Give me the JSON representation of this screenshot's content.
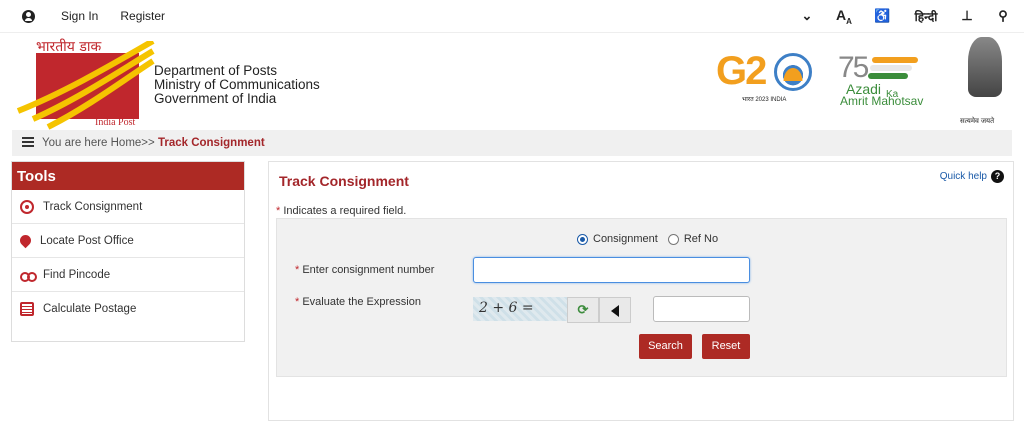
{
  "topbar": {
    "sign_in": "Sign In",
    "register": "Register",
    "hindi": "हिन्दी",
    "icons": [
      "user-icon",
      "chevron-down-icon",
      "font-size-icon",
      "accessibility-icon",
      "sitemap-icon",
      "search-icon"
    ]
  },
  "header": {
    "logo_hindi": "भारतीय डाक",
    "logo_english": "India Post",
    "dept_line1": "Department of Posts",
    "dept_line2": "Ministry of Communications",
    "dept_line3": "Government of India",
    "g20_text": "G20",
    "g20_sub": "भारत 2023 INDIA",
    "azadi_75": "75",
    "azadi_word": "Azadi",
    "azadi_ka": "Ka",
    "azadi_line2": "Amrit Mahotsav",
    "emblem_motto": "सत्यमेव जयते",
    "brand_color": "#c0272d"
  },
  "breadcrumb": {
    "prefix": "You are here Home>>",
    "current": "Track Consignment"
  },
  "tools": {
    "heading": "Tools",
    "items": [
      {
        "label": "Track Consignment",
        "icon": "target-icon"
      },
      {
        "label": "Locate Post Office",
        "icon": "map-pin-icon"
      },
      {
        "label": "Find Pincode",
        "icon": "binoculars-icon"
      },
      {
        "label": "Calculate Postage",
        "icon": "calculator-icon"
      }
    ]
  },
  "main": {
    "title": "Track Consignment",
    "quick_help": "Quick help",
    "required_note": "Indicates a required field.",
    "radio_consignment": "Consignment",
    "radio_refno": "Ref No",
    "consignment_label": "Enter consignment number",
    "consignment_value": "",
    "expression_label": "Evaluate the Expression",
    "captcha_text": "2 + 6 =",
    "answer_value": "",
    "search_button": "Search",
    "reset_button": "Reset"
  }
}
